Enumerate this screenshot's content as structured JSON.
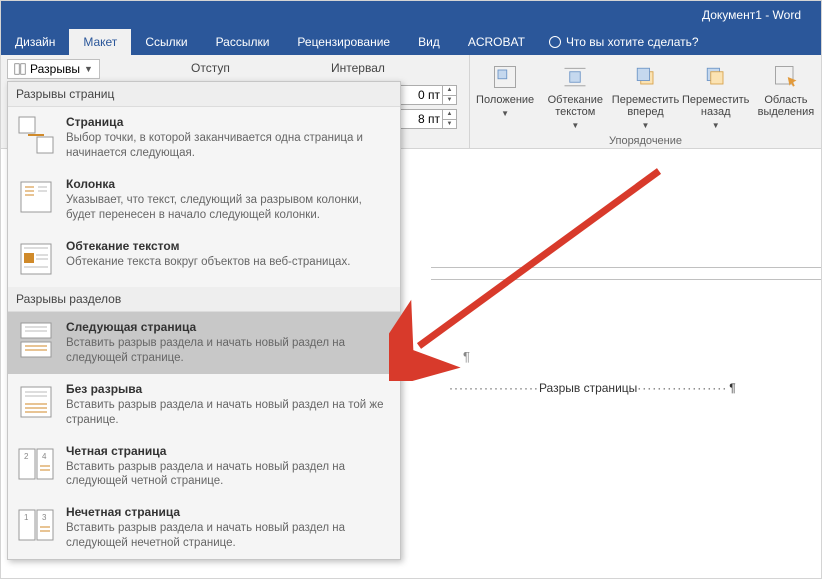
{
  "title": "Документ1 - Word",
  "tabs": [
    "Дизайн",
    "Макет",
    "Ссылки",
    "Рассылки",
    "Рецензирование",
    "Вид",
    "ACROBAT"
  ],
  "active_tab_index": 1,
  "tell_me": "Что вы хотите сделать?",
  "breaks_button": "Разрывы",
  "indent_label": "Отступ",
  "interval_label": "Интервал",
  "spinner_before": "0 пт",
  "spinner_after": "8 пт",
  "arrange": {
    "position": "Положение",
    "wrap": "Обтекание текстом",
    "forward": "Переместить вперед",
    "backward": "Переместить назад",
    "pane": "Область выделения",
    "group_label": "Упорядочение"
  },
  "dropdown": {
    "page_breaks_header": "Разрывы страниц",
    "section_breaks_header": "Разрывы разделов",
    "items_page": [
      {
        "title": "Страница",
        "desc": "Выбор точки, в которой заканчивается одна страница и начинается следующая."
      },
      {
        "title": "Колонка",
        "desc": "Указывает, что текст, следующий за разрывом колонки, будет перенесен в начало следующей колонки."
      },
      {
        "title": "Обтекание текстом",
        "desc": "Обтекание текста вокруг объектов на веб-страницах."
      }
    ],
    "items_section": [
      {
        "title": "Следующая страница",
        "desc": "Вставить разрыв раздела и начать новый раздел на следующей странице."
      },
      {
        "title": "Без разрыва",
        "desc": "Вставить разрыв раздела и начать новый раздел на той же странице."
      },
      {
        "title": "Четная страница",
        "desc": "Вставить разрыв раздела и начать новый раздел на следующей четной странице."
      },
      {
        "title": "Нечетная страница",
        "desc": "Вставить разрыв раздела и начать новый раздел на следующей нечетной странице."
      }
    ]
  },
  "doc": {
    "pilcrow": "¶",
    "break_text": "Разрыв страницы",
    "dots_left": "··················",
    "dots_right": "··················"
  }
}
